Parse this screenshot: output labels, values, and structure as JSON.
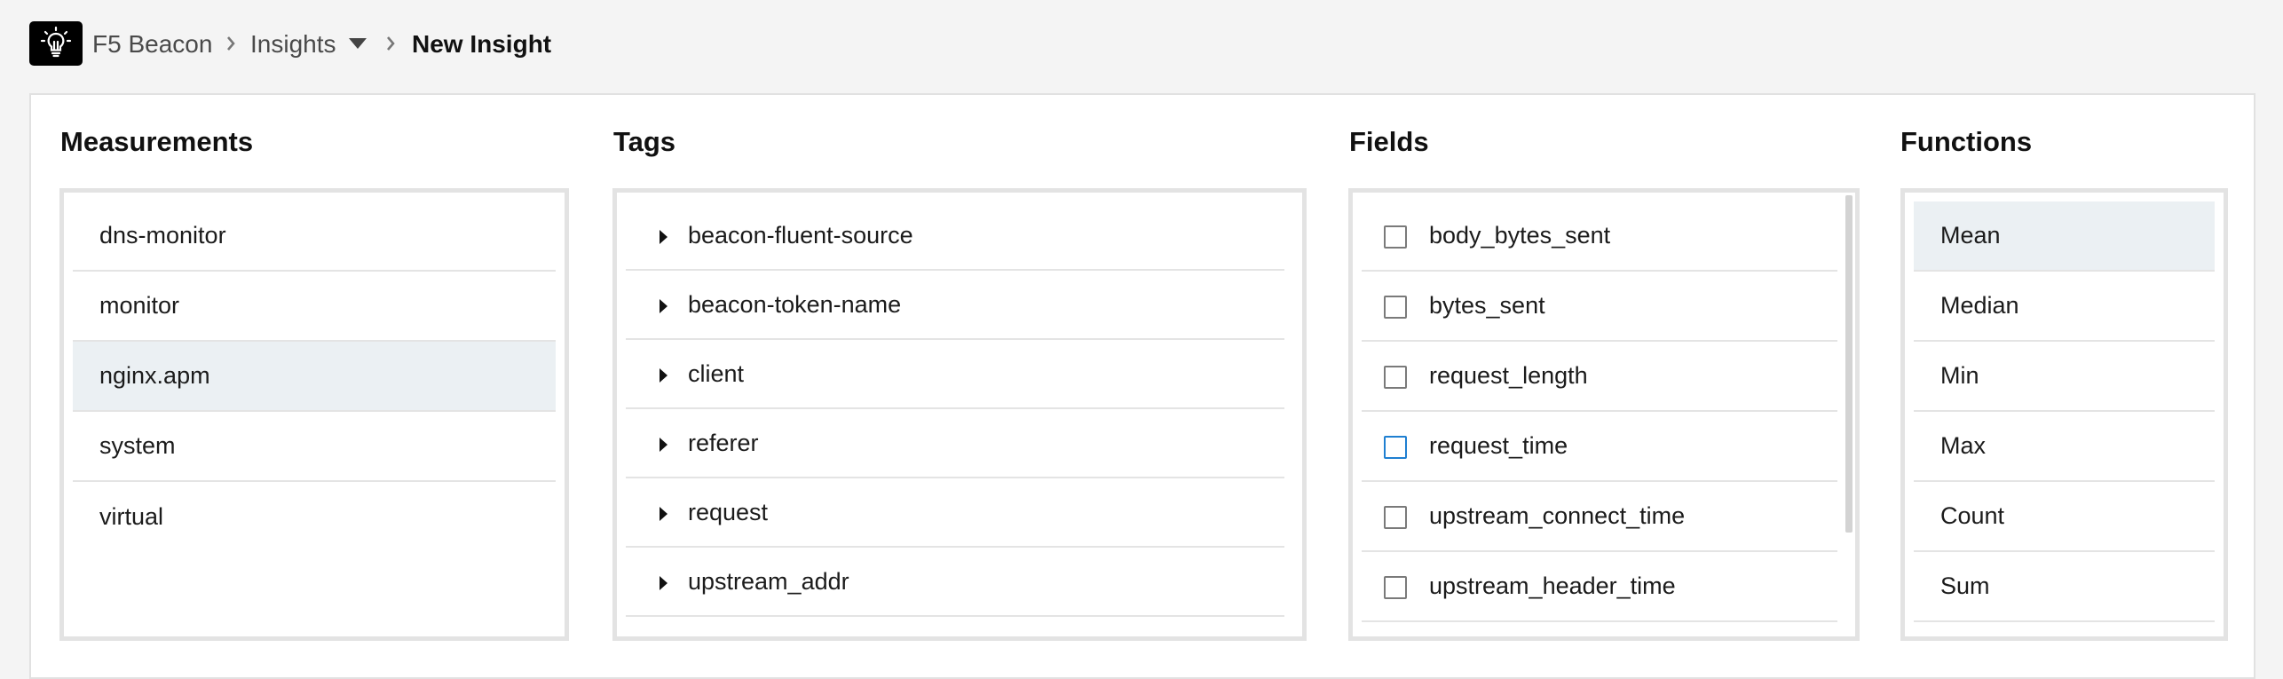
{
  "breadcrumb": {
    "home": "F5 Beacon",
    "section": "Insights",
    "current": "New Insight"
  },
  "icons": {
    "logo": "lightbulb-icon",
    "separator": "chevron-right-icon",
    "dropdown": "caret-down-icon",
    "expand": "triangle-right-icon"
  },
  "colors": {
    "selected_row": "#ebf0f3",
    "focus_checkbox": "#1f7fd1"
  },
  "measurements": {
    "title": "Measurements",
    "items": [
      "dns-monitor",
      "monitor",
      "nginx.apm",
      "system",
      "virtual"
    ],
    "selected": "nginx.apm"
  },
  "tags": {
    "title": "Tags",
    "items": [
      "beacon-fluent-source",
      "beacon-token-name",
      "client",
      "referer",
      "request",
      "upstream_addr"
    ]
  },
  "fields": {
    "title": "Fields",
    "items": [
      "body_bytes_sent",
      "bytes_sent",
      "request_length",
      "request_time",
      "upstream_connect_time",
      "upstream_header_time"
    ],
    "focused": "request_time"
  },
  "functions": {
    "title": "Functions",
    "items": [
      "Mean",
      "Median",
      "Min",
      "Max",
      "Count",
      "Sum"
    ],
    "selected": "Mean"
  }
}
